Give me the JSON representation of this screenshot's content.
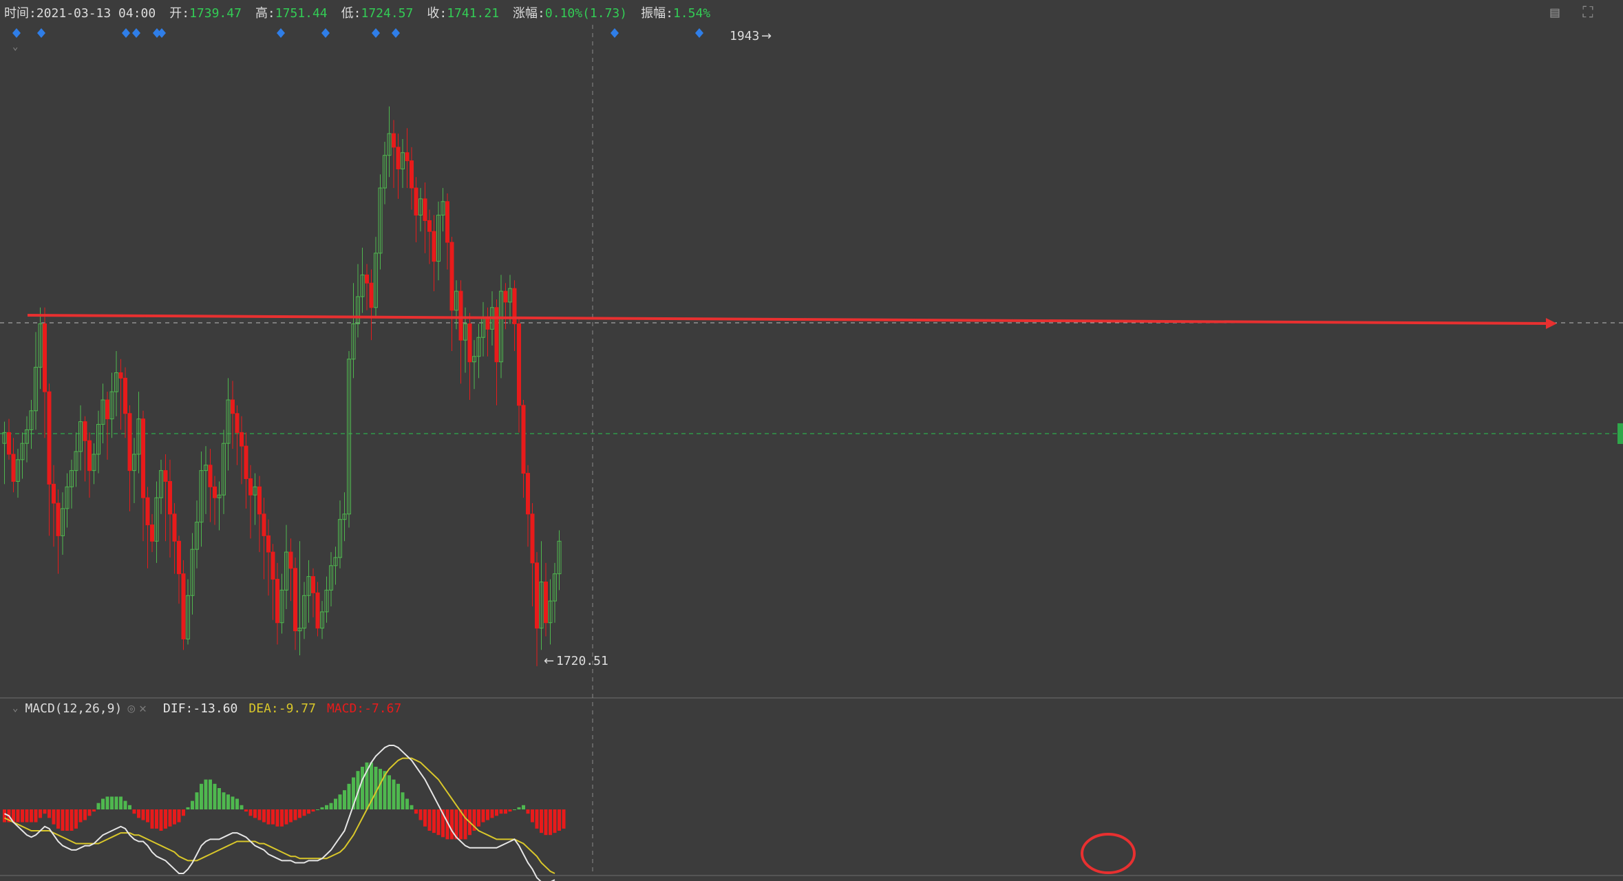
{
  "info_bar": {
    "time_label": "时间:",
    "time_value": "2021-03-13 04:00",
    "open_label": "开:",
    "open_value": "1739.47",
    "high_label": "高:",
    "high_value": "1751.44",
    "low_label": "低:",
    "low_value": "1724.57",
    "close_label": "收:",
    "close_value": "1741.21",
    "change_label": "涨幅:",
    "change_value": "0.10%(1.73)",
    "amplitude_label": "振幅:",
    "amplitude_value": "1.54%"
  },
  "macd_legend": {
    "name": "MACD(12,26,9)",
    "dif": "DIF:-13.60",
    "dea": "DEA:-9.77",
    "macd": "MACD:-7.67"
  },
  "colors": {
    "background": "#3c3c3c",
    "up": "#4fb84f",
    "down": "#e81b1b",
    "dif_line": "#e6e6e6",
    "dea_line": "#d9c72a",
    "marker": "#2f7ee8",
    "annotation": "#e83030",
    "guide_dashed": "#2f9a4a"
  },
  "chart_data": {
    "type": "candlestick",
    "high_label": "1943",
    "low_label": "1720.51",
    "candles": [
      [
        1796,
        1800,
        1781,
        1804
      ],
      [
        1800,
        1792,
        1790,
        1805
      ],
      [
        1792,
        1782,
        1778,
        1798
      ],
      [
        1782,
        1790,
        1776,
        1794
      ],
      [
        1790,
        1796,
        1783,
        1800
      ],
      [
        1796,
        1801,
        1789,
        1806
      ],
      [
        1801,
        1808,
        1794,
        1812
      ],
      [
        1808,
        1824,
        1801,
        1837
      ],
      [
        1824,
        1840,
        1816,
        1846
      ],
      [
        1840,
        1815,
        1798,
        1846
      ],
      [
        1815,
        1781,
        1762,
        1818
      ],
      [
        1781,
        1774,
        1758,
        1788
      ],
      [
        1774,
        1762,
        1748,
        1779
      ],
      [
        1762,
        1772,
        1755,
        1778
      ],
      [
        1772,
        1780,
        1765,
        1785
      ],
      [
        1780,
        1786,
        1772,
        1790
      ],
      [
        1786,
        1793,
        1780,
        1800
      ],
      [
        1793,
        1804,
        1786,
        1810
      ],
      [
        1804,
        1797,
        1782,
        1806
      ],
      [
        1797,
        1786,
        1776,
        1800
      ],
      [
        1786,
        1792,
        1781,
        1796
      ],
      [
        1792,
        1803,
        1785,
        1808
      ],
      [
        1803,
        1812,
        1796,
        1818
      ],
      [
        1812,
        1805,
        1790,
        1815
      ],
      [
        1805,
        1815,
        1798,
        1822
      ],
      [
        1815,
        1822,
        1806,
        1830
      ],
      [
        1822,
        1820,
        1801,
        1827
      ],
      [
        1820,
        1807,
        1798,
        1824
      ],
      [
        1807,
        1786,
        1771,
        1810
      ],
      [
        1786,
        1792,
        1774,
        1798
      ],
      [
        1792,
        1805,
        1785,
        1815
      ],
      [
        1805,
        1776,
        1760,
        1808
      ],
      [
        1776,
        1766,
        1750,
        1780
      ],
      [
        1766,
        1760,
        1756,
        1770
      ],
      [
        1760,
        1776,
        1752,
        1782
      ],
      [
        1776,
        1786,
        1770,
        1790
      ],
      [
        1786,
        1782,
        1760,
        1792
      ],
      [
        1782,
        1770,
        1754,
        1790
      ],
      [
        1770,
        1760,
        1748,
        1774
      ],
      [
        1760,
        1748,
        1737,
        1762
      ],
      [
        1748,
        1724,
        1720,
        1753
      ],
      [
        1724,
        1740,
        1722,
        1746
      ],
      [
        1740,
        1757,
        1733,
        1763
      ],
      [
        1757,
        1767,
        1750,
        1775
      ],
      [
        1767,
        1786,
        1758,
        1793
      ],
      [
        1786,
        1788,
        1770,
        1795
      ],
      [
        1788,
        1780,
        1767,
        1794
      ],
      [
        1780,
        1776,
        1766,
        1784
      ],
      [
        1776,
        1777,
        1764,
        1782
      ],
      [
        1777,
        1796,
        1770,
        1801
      ],
      [
        1796,
        1812,
        1786,
        1820
      ],
      [
        1812,
        1807,
        1794,
        1819
      ],
      [
        1807,
        1800,
        1788,
        1810
      ],
      [
        1800,
        1795,
        1781,
        1806
      ],
      [
        1795,
        1783,
        1772,
        1800
      ],
      [
        1783,
        1777,
        1761,
        1788
      ],
      [
        1777,
        1780,
        1766,
        1785
      ],
      [
        1780,
        1770,
        1756,
        1784
      ],
      [
        1770,
        1762,
        1746,
        1776
      ],
      [
        1762,
        1756,
        1740,
        1768
      ],
      [
        1756,
        1746,
        1731,
        1759
      ],
      [
        1746,
        1730,
        1722,
        1752
      ],
      [
        1730,
        1742,
        1726,
        1748
      ],
      [
        1742,
        1756,
        1735,
        1766
      ],
      [
        1756,
        1750,
        1738,
        1761
      ],
      [
        1750,
        1727,
        1720,
        1754
      ],
      [
        1727,
        1728,
        1718,
        1760
      ],
      [
        1728,
        1740,
        1724,
        1745
      ],
      [
        1740,
        1747,
        1730,
        1753
      ],
      [
        1747,
        1741,
        1732,
        1750
      ],
      [
        1741,
        1728,
        1725,
        1745
      ],
      [
        1728,
        1734,
        1724,
        1738
      ],
      [
        1734,
        1742,
        1730,
        1747
      ],
      [
        1742,
        1751,
        1736,
        1756
      ],
      [
        1751,
        1754,
        1744,
        1758
      ],
      [
        1754,
        1768,
        1750,
        1775
      ],
      [
        1768,
        1770,
        1760,
        1778
      ],
      [
        1770,
        1827,
        1765,
        1830
      ],
      [
        1827,
        1840,
        1820,
        1855
      ],
      [
        1840,
        1850,
        1835,
        1862
      ],
      [
        1850,
        1858,
        1844,
        1868
      ],
      [
        1858,
        1855,
        1845,
        1862
      ],
      [
        1855,
        1846,
        1834,
        1860
      ],
      [
        1846,
        1866,
        1842,
        1872
      ],
      [
        1866,
        1890,
        1860,
        1895
      ],
      [
        1890,
        1902,
        1884,
        1907
      ],
      [
        1902,
        1910,
        1894,
        1920
      ],
      [
        1910,
        1905,
        1890,
        1915
      ],
      [
        1905,
        1897,
        1886,
        1910
      ],
      [
        1897,
        1903,
        1890,
        1908
      ],
      [
        1903,
        1900,
        1890,
        1912
      ],
      [
        1900,
        1890,
        1882,
        1905
      ],
      [
        1890,
        1880,
        1870,
        1894
      ],
      [
        1880,
        1886,
        1874,
        1890
      ],
      [
        1886,
        1878,
        1866,
        1892
      ],
      [
        1878,
        1874,
        1862,
        1882
      ],
      [
        1874,
        1863,
        1852,
        1880
      ],
      [
        1863,
        1880,
        1856,
        1885
      ],
      [
        1880,
        1885,
        1874,
        1890
      ],
      [
        1885,
        1870,
        1860,
        1888
      ],
      [
        1870,
        1845,
        1830,
        1872
      ],
      [
        1845,
        1852,
        1838,
        1856
      ],
      [
        1852,
        1834,
        1818,
        1856
      ],
      [
        1834,
        1840,
        1822,
        1846
      ],
      [
        1840,
        1826,
        1812,
        1844
      ],
      [
        1826,
        1828,
        1816,
        1834
      ],
      [
        1828,
        1835,
        1820,
        1840
      ],
      [
        1835,
        1842,
        1828,
        1848
      ],
      [
        1842,
        1838,
        1828,
        1846
      ],
      [
        1838,
        1846,
        1832,
        1852
      ],
      [
        1846,
        1826,
        1810,
        1849
      ],
      [
        1826,
        1852,
        1820,
        1858
      ],
      [
        1852,
        1848,
        1838,
        1855
      ],
      [
        1848,
        1853,
        1840,
        1858
      ],
      [
        1853,
        1840,
        1830,
        1856
      ],
      [
        1840,
        1810,
        1800,
        1842
      ],
      [
        1810,
        1785,
        1776,
        1812
      ],
      [
        1785,
        1770,
        1758,
        1788
      ],
      [
        1770,
        1752,
        1736,
        1774
      ],
      [
        1752,
        1728,
        1714,
        1756
      ],
      [
        1728,
        1745,
        1720,
        1760
      ],
      [
        1745,
        1730,
        1725,
        1752
      ],
      [
        1730,
        1738,
        1722,
        1746
      ],
      [
        1738,
        1748,
        1730,
        1752
      ],
      [
        1748,
        1760,
        1742,
        1764
      ]
    ],
    "macd": {
      "dif": [
        -2,
        -3,
        -6,
        -8,
        -10,
        -12,
        -13,
        -12,
        -10,
        -8,
        -9,
        -12,
        -15,
        -17,
        -18,
        -19,
        -19,
        -18,
        -17,
        -17,
        -16,
        -14,
        -12,
        -11,
        -10,
        -9,
        -8,
        -9,
        -12,
        -14,
        -15,
        -15,
        -17,
        -20,
        -22,
        -23,
        -24,
        -26,
        -28,
        -30,
        -30,
        -28,
        -25,
        -21,
        -17,
        -15,
        -14,
        -14,
        -14,
        -13,
        -12,
        -11,
        -11,
        -12,
        -13,
        -15,
        -17,
        -18,
        -19,
        -21,
        -22,
        -23,
        -24,
        -24,
        -24,
        -25,
        -25,
        -25,
        -24,
        -24,
        -24,
        -23,
        -21,
        -19,
        -16,
        -13,
        -10,
        -4,
        2,
        8,
        14,
        18,
        22,
        25,
        27,
        29,
        30,
        30,
        29,
        27,
        25,
        23,
        20,
        17,
        14,
        10,
        6,
        2,
        -2,
        -6,
        -10,
        -13,
        -15,
        -17,
        -18,
        -18,
        -18,
        -18,
        -18,
        -18,
        -18,
        -17,
        -16,
        -15,
        -14,
        -17,
        -21,
        -25,
        -28,
        -32,
        -34,
        -35,
        -34,
        -33
      ],
      "dea": [
        -4,
        -5,
        -6,
        -7,
        -8,
        -9,
        -10,
        -10,
        -10,
        -10,
        -10,
        -11,
        -12,
        -13,
        -14,
        -15,
        -16,
        -16,
        -16,
        -16,
        -16,
        -16,
        -15,
        -14,
        -13,
        -12,
        -11,
        -11,
        -11,
        -12,
        -12,
        -13,
        -14,
        -15,
        -16,
        -17,
        -18,
        -19,
        -20,
        -22,
        -23,
        -24,
        -24,
        -24,
        -23,
        -22,
        -21,
        -20,
        -19,
        -18,
        -17,
        -16,
        -15,
        -15,
        -15,
        -15,
        -15,
        -16,
        -16,
        -17,
        -18,
        -19,
        -20,
        -21,
        -22,
        -22,
        -23,
        -23,
        -23,
        -23,
        -23,
        -23,
        -23,
        -22,
        -21,
        -20,
        -18,
        -15,
        -12,
        -8,
        -4,
        0,
        4,
        8,
        12,
        16,
        19,
        21,
        23,
        24,
        24,
        24,
        23,
        22,
        20,
        18,
        16,
        14,
        11,
        8,
        5,
        2,
        -1,
        -4,
        -6,
        -8,
        -10,
        -11,
        -12,
        -13,
        -14,
        -14,
        -14,
        -14,
        -14,
        -15,
        -16,
        -18,
        -20,
        -22,
        -25,
        -27,
        -29,
        -30
      ],
      "hist": [
        -6,
        -6,
        -6,
        -6,
        -6,
        -6,
        -6,
        -6,
        -4,
        -2,
        -4,
        -7,
        -9,
        -10,
        -10,
        -10,
        -9,
        -6,
        -5,
        -3,
        -1,
        3,
        5,
        6,
        6,
        6,
        6,
        4,
        2,
        -2,
        -4,
        -5,
        -6,
        -9,
        -9,
        -10,
        -9,
        -8,
        -7,
        -6,
        -3,
        1,
        4,
        8,
        12,
        14,
        14,
        12,
        10,
        8,
        7,
        6,
        5,
        2,
        -1,
        -3,
        -4,
        -5,
        -6,
        -7,
        -7,
        -8,
        -8,
        -7,
        -6,
        -5,
        -4,
        -3,
        -2,
        -1,
        0,
        1,
        2,
        3,
        5,
        7,
        9,
        12,
        15,
        18,
        20,
        22,
        22,
        20,
        19,
        18,
        16,
        14,
        12,
        8,
        5,
        2,
        -2,
        -5,
        -8,
        -10,
        -11,
        -12,
        -13,
        -14,
        -14,
        -14,
        -14,
        -14,
        -12,
        -10,
        -8,
        -6,
        -5,
        -4,
        -3,
        -2,
        -2,
        -1,
        0,
        1,
        2,
        -2,
        -6,
        -9,
        -11,
        -12,
        -12,
        -11,
        -10,
        -9
      ]
    },
    "markers_x": [
      24,
      60,
      183,
      198,
      228,
      235,
      408,
      473,
      546,
      575,
      893,
      1016
    ]
  }
}
